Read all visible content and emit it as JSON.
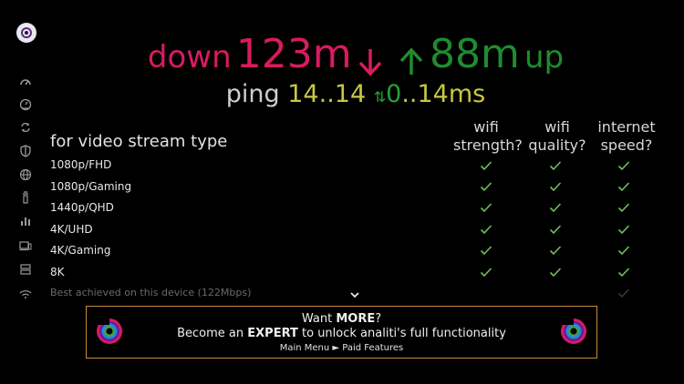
{
  "speed": {
    "down_label": "down",
    "down_value": "123m",
    "up_value": "88m",
    "up_label": "up"
  },
  "ping": {
    "label": "ping",
    "min": "14",
    "sep1": "..",
    "max": "14",
    "jitter_min": "0",
    "sep2": "..",
    "jitter_max": "14",
    "unit": "ms"
  },
  "table": {
    "section_title": "for video stream type",
    "columns": [
      {
        "line1": "wifi",
        "line2": "strength?"
      },
      {
        "line1": "wifi",
        "line2": "quality?"
      },
      {
        "line1": "internet",
        "line2": "speed?"
      }
    ],
    "rows": [
      {
        "label": "1080p/FHD"
      },
      {
        "label": "1080p/Gaming"
      },
      {
        "label": "1440p/QHD"
      },
      {
        "label": "4K/UHD"
      },
      {
        "label": "4K/Gaming"
      },
      {
        "label": "8K"
      }
    ],
    "best_note": "Best achieved on this device (122Mbps)"
  },
  "promo": {
    "line1_pre": "Want ",
    "line1_bold": "MORE",
    "line1_post": "?",
    "line2_pre": "Become an ",
    "line2_bold": "EXPERT",
    "line2_post": " to unlock analiti's full functionality",
    "line3": "Main Menu ► Paid Features"
  },
  "colors": {
    "download": "#d81b60",
    "upload": "#1e8c2f",
    "ping": "#c7c840",
    "check": "#6fbf5a",
    "promo_border": "#c98b3b"
  },
  "sidebar_icons": [
    "speedometer-icon",
    "gauge-icon",
    "sync-icon",
    "shield-icon",
    "globe-icon",
    "router-icon",
    "bar-chart-icon",
    "devices-icon",
    "server-icon",
    "wifi-icon"
  ]
}
